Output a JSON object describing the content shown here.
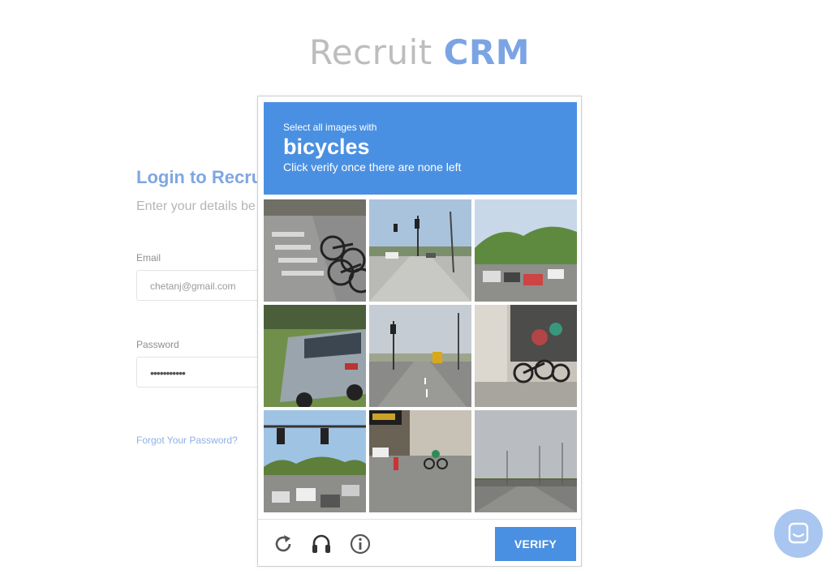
{
  "logo": {
    "word1": "Recruit",
    "word2": "CRM"
  },
  "login": {
    "title": "Login to Recrui",
    "subtitle": "Enter your details be",
    "email_label": "Email",
    "email_value": "chetanj@gmail.com",
    "password_label": "Password",
    "password_value": "•••••••••••",
    "forgot_link": "Forgot Your Password?"
  },
  "captcha": {
    "instruction": "Select all images with",
    "target": "bicycles",
    "hint": "Click verify once there are none left",
    "tiles": [
      "crosswalk with parked bicycles",
      "road intersection with traffic lights",
      "street with cars and green hills",
      "parked silver minivan on grass",
      "road with traffic light and bus",
      "bicycles parked at storefront",
      "intersection with traffic lights and cars",
      "cyclist crossing street",
      "highway under an overpass"
    ],
    "verify_label": "VERIFY",
    "icons": [
      "reload-icon",
      "audio-icon",
      "info-icon"
    ]
  },
  "colors": {
    "brand": "#4a90e2",
    "logo_accent": "#7ba4e4",
    "chat": "#a9c6f0"
  },
  "chat": {
    "icon": "chat-icon"
  }
}
